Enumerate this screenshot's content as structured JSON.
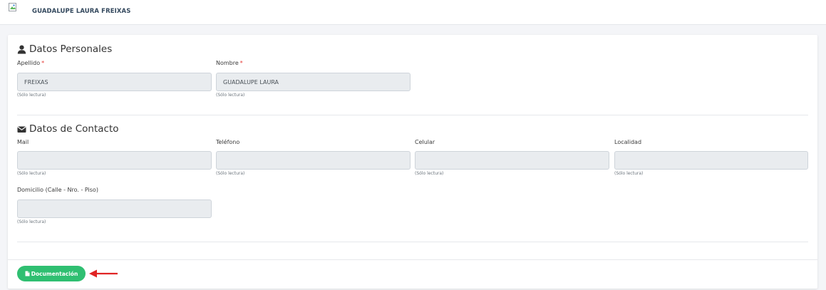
{
  "header": {
    "user_name": "GUADALUPE LAURA FREIXAS"
  },
  "personal": {
    "title": "Datos Personales",
    "apellido_label": "Apellido",
    "apellido_value": "FREIXAS",
    "apellido_help": "(Sólo lectura)",
    "nombre_label": "Nombre",
    "nombre_value": "GUADALUPE LAURA",
    "nombre_help": "(Sólo lectura)",
    "required_mark": "*"
  },
  "contact": {
    "title": "Datos de Contacto",
    "mail_label": "Mail",
    "mail_value": "",
    "mail_help": "(Sólo lectura)",
    "telefono_label": "Teléfono",
    "telefono_value": "",
    "telefono_help": "(Sólo lectura)",
    "celular_label": "Celular",
    "celular_value": "",
    "celular_help": "(Sólo lectura)",
    "localidad_label": "Localidad",
    "localidad_value": "",
    "localidad_help": "(Sólo lectura)",
    "domicilio_label": "Domicilio (Calle - Nro. - Piso)",
    "domicilio_value": "",
    "domicilio_help": "(Sólo lectura)"
  },
  "footer": {
    "documentacion_label": "Documentación"
  },
  "icons": {
    "personal": "user-icon",
    "contact": "envelope-icon",
    "documentacion": "file-icon",
    "arrow": "left-arrow-icon"
  },
  "colors": {
    "button": "#2fbf71",
    "arrow": "#e02424",
    "required": "#e53935"
  }
}
